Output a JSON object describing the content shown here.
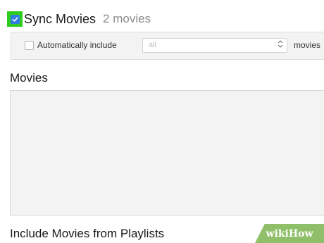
{
  "sync": {
    "checked": true,
    "title": "Sync Movies",
    "count": "2 movies"
  },
  "filter": {
    "checkbox_label": "Automatically include",
    "select_value": "all",
    "suffix": "movies"
  },
  "movies_section": {
    "title": "Movies",
    "items": []
  },
  "playlists_section": {
    "title": "Include Movies from Playlists"
  },
  "watermark": {
    "prefix": "wiki",
    "suffix": "How"
  },
  "colors": {
    "highlight": "#2ecc1f",
    "checkbox_blue": "#2f7de1",
    "watermark_green": "#8fbf68"
  }
}
